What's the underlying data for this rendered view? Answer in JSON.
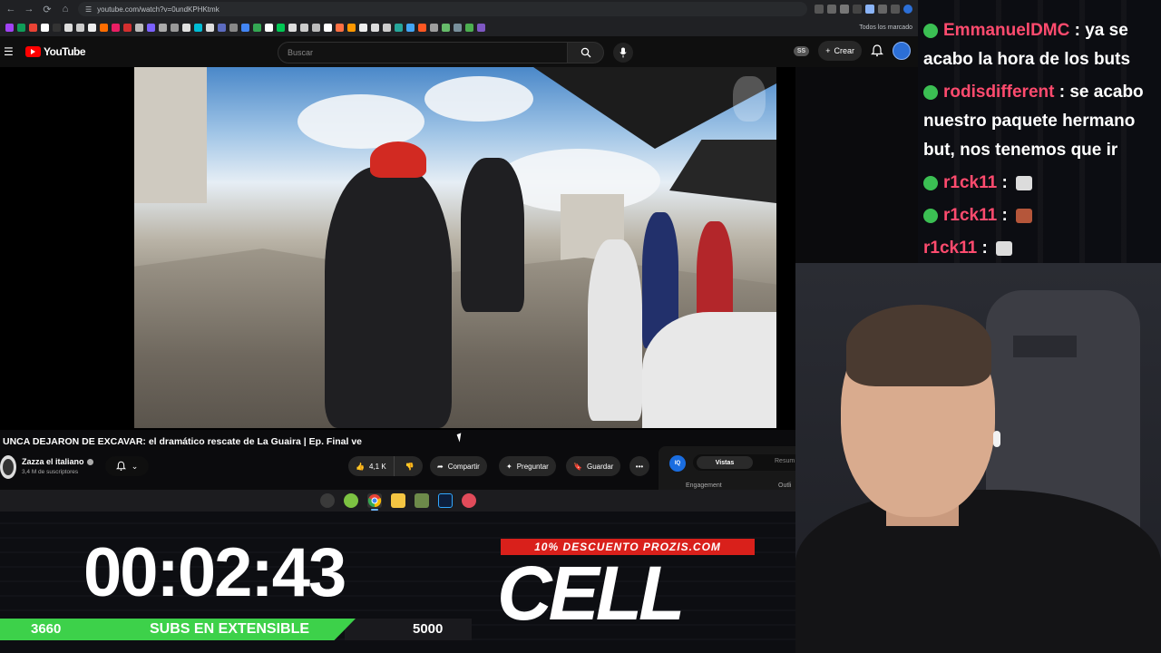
{
  "browser": {
    "url": "youtube.com/watch?v=0undKPHKtmk",
    "bookmarks_all": "Todos los marcado"
  },
  "youtube": {
    "logo": "YouTube",
    "search_placeholder": "Buscar",
    "ss_badge": "SS",
    "create_label": "Crear"
  },
  "video": {
    "title": "UNCA DEJARON DE EXCAVAR: el dramático rescate de La Guaira | Ep. Final ve",
    "channel_name": "Zazza el italiano",
    "channel_subs": "3,4 M de suscriptores",
    "likes": "4,1 K",
    "share_label": "Compartir",
    "ask_label": "Preguntar",
    "save_label": "Guardar"
  },
  "side_panel": {
    "iq": "IQ",
    "tab_active": "Vistas",
    "tab_other": "Resum",
    "engagement": "Engagement",
    "outline": "Outli"
  },
  "stream": {
    "timer": "00:02:43",
    "subs_current": "3660",
    "subs_label": "SUBS EN EXTENSIBLE",
    "subs_goal": "5000",
    "subs_progress": 0.732,
    "promo": "10% DESCUENTO PROZIS.COM",
    "sponsor": "CELL"
  },
  "chat": [
    {
      "user": "EmmanuelDMC",
      "text": " : ya se acabo la hora de los buts",
      "badge": true
    },
    {
      "user": "rodisdifferent",
      "text": " : se acabo nuestro paquete hermano but, nos tenemos que ir",
      "badge": true
    },
    {
      "user": "r1ck11",
      "text": " : ",
      "badge": true
    },
    {
      "user": "r1ck11",
      "text": " : ",
      "badge": true
    },
    {
      "user": "r1ck11",
      "text": " : ",
      "badge": false
    }
  ],
  "colors": {
    "yt_red": "#ff0000",
    "subs_green": "#3dd14a",
    "promo_red": "#d9201b",
    "chat_user": "#ff4b6e"
  }
}
